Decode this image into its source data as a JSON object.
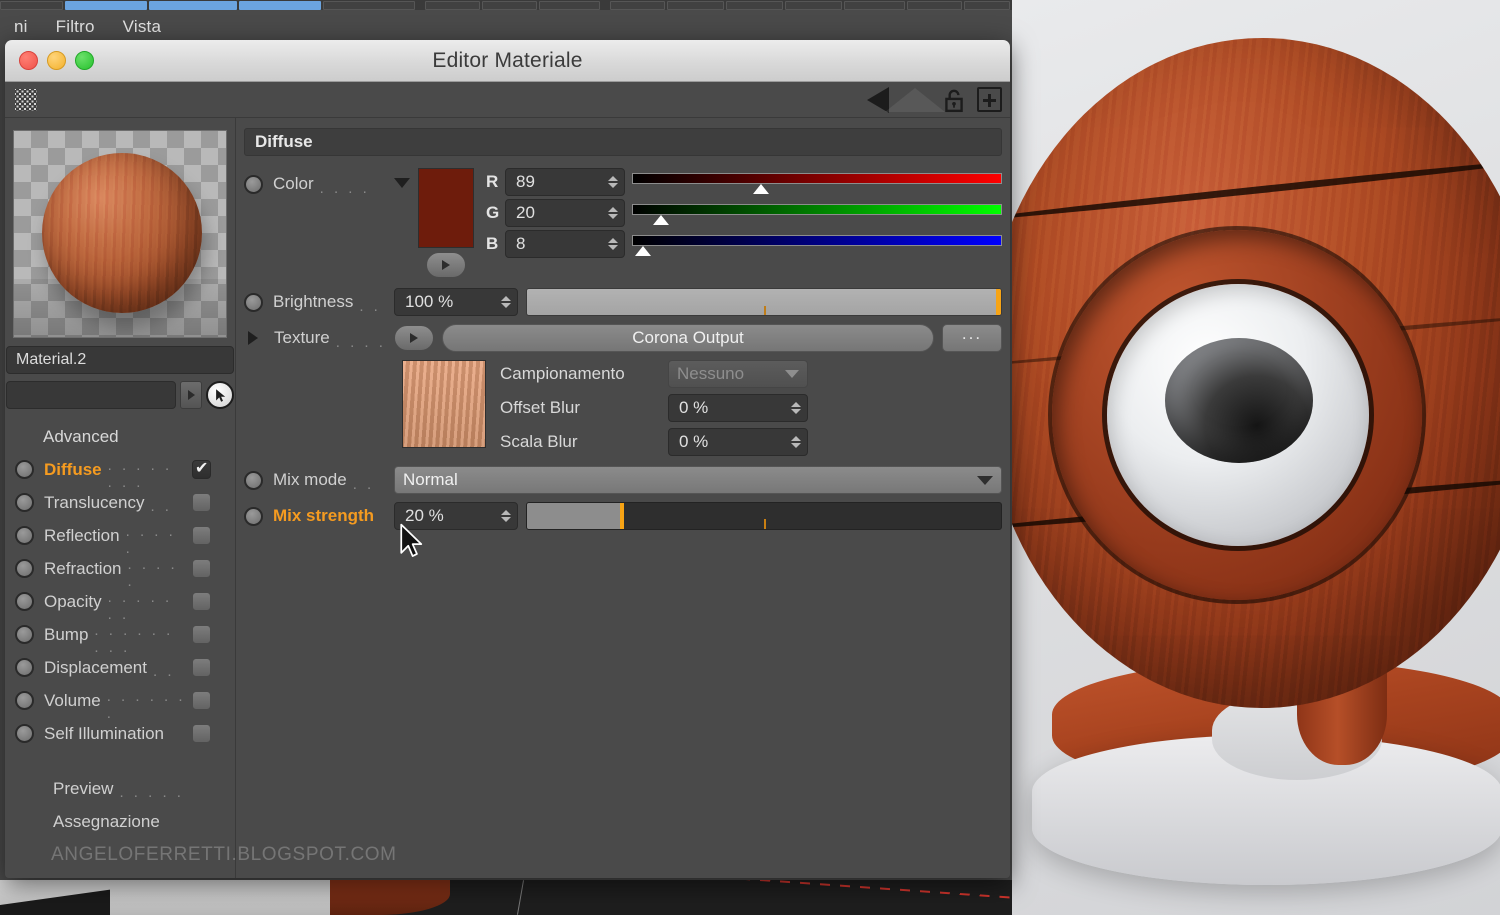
{
  "app": {
    "menu": [
      "ni",
      "Filtro",
      "Vista"
    ]
  },
  "window": {
    "title": "Editor Materiale",
    "toolbar": {
      "grip": "grip-handle",
      "back": "back-arrow-icon",
      "forward": "forward-arrow-icon",
      "lock": "lock-open-icon",
      "add": "add-icon"
    }
  },
  "sidebar": {
    "material_name": "Material.2",
    "secondary_field": "",
    "picker": "eyedropper-cursor-icon",
    "advanced_header": "Advanced",
    "channels": [
      {
        "label": "Diffuse",
        "dots": ". . . . . . . .",
        "active": true,
        "checked": true
      },
      {
        "label": "Translucency",
        "dots": ". .",
        "active": false,
        "checked": false
      },
      {
        "label": "Reflection",
        "dots": ". . . . .",
        "active": false,
        "checked": false
      },
      {
        "label": "Refraction",
        "dots": ". . . . .",
        "active": false,
        "checked": false
      },
      {
        "label": "Opacity",
        "dots": ". . . . . . .",
        "active": false,
        "checked": false
      },
      {
        "label": "Bump",
        "dots": ". . . . . . . . .",
        "active": false,
        "checked": false
      },
      {
        "label": "Displacement",
        "dots": ". .",
        "active": false,
        "checked": false
      },
      {
        "label": "Volume",
        "dots": ". . . . . . .",
        "active": false,
        "checked": false
      },
      {
        "label": "Self Illumination",
        "dots": "",
        "active": false,
        "checked": false
      }
    ],
    "footer": [
      {
        "label": "Preview",
        "dots": ". . . . ."
      },
      {
        "label": "Assegnazione",
        "dots": ""
      }
    ],
    "watermark": "ANGELOFERRETTI.BLOGSPOT.COM"
  },
  "main": {
    "section_title": "Diffuse",
    "color": {
      "label": "Color",
      "dots": ". . . .",
      "swatch_hex": "#6e1c0c",
      "channels": [
        {
          "letter": "R",
          "value": "89",
          "percent": 34.9
        },
        {
          "letter": "G",
          "value": "20",
          "percent": 7.8
        },
        {
          "letter": "B",
          "value": "8",
          "percent": 3.1
        }
      ]
    },
    "brightness": {
      "label": "Brightness",
      "dots": ". .",
      "value": "100 %",
      "percent": 100
    },
    "texture": {
      "label": "Texture",
      "dots": ". . . .",
      "shader_name": "Corona Output",
      "browse_label": "...",
      "sampling_label": "Campionamento",
      "sampling_value": "Nessuno",
      "offset_blur_label": "Offset Blur",
      "offset_blur_value": "0 %",
      "scale_blur_label": "Scala Blur",
      "scale_blur_value": "0 %"
    },
    "mix_mode": {
      "label": "Mix mode",
      "dots": ". .",
      "value": "Normal"
    },
    "mix_strength": {
      "label": "Mix strength",
      "value": "20 %",
      "percent": 20,
      "tick_percent": 50,
      "accent_hex": "#f7a415"
    }
  }
}
